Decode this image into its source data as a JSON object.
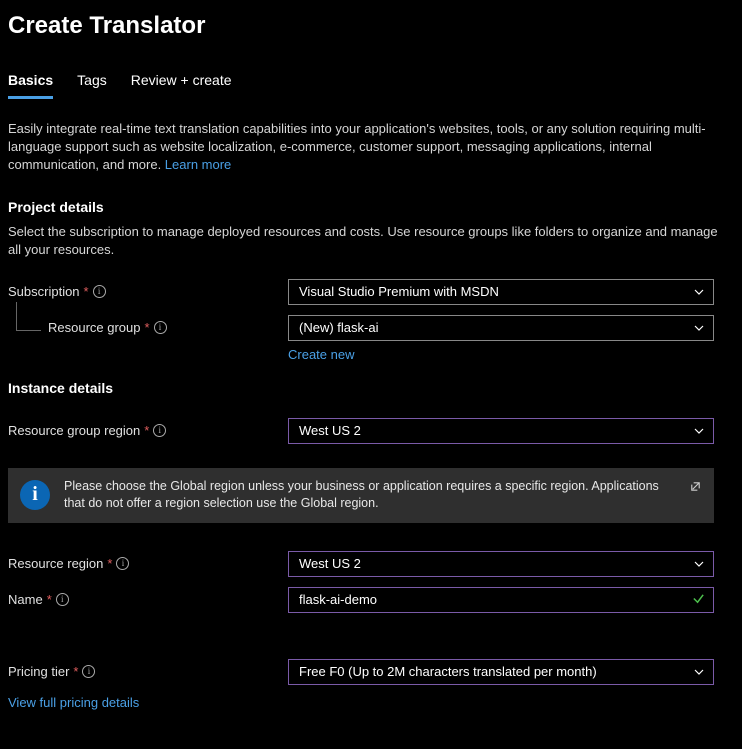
{
  "title": "Create Translator",
  "tabs": [
    {
      "label": "Basics",
      "active": true
    },
    {
      "label": "Tags",
      "active": false
    },
    {
      "label": "Review + create",
      "active": false
    }
  ],
  "intro": "Easily integrate real-time text translation capabilities into your application's websites, tools, or any solution requiring multi-language support such as website localization, e-commerce, customer support, messaging applications, internal communication, and more. ",
  "learn_more": "Learn more",
  "project": {
    "title": "Project details",
    "desc": "Select the subscription to manage deployed resources and costs. Use resource groups like folders to organize and manage all your resources.",
    "subscription_label": "Subscription",
    "subscription_value": "Visual Studio Premium with MSDN",
    "resource_group_label": "Resource group",
    "resource_group_value": "(New) flask-ai",
    "create_new": "Create new"
  },
  "instance": {
    "title": "Instance details",
    "rg_region_label": "Resource group region",
    "rg_region_value": "West US 2",
    "info": "Please choose the Global region unless your business or application requires a specific region. Applications that do not offer a region selection use the Global region.",
    "resource_region_label": "Resource region",
    "resource_region_value": "West US 2",
    "name_label": "Name",
    "name_value": "flask-ai-demo",
    "pricing_label": "Pricing tier",
    "pricing_value": "Free F0 (Up to 2M characters translated per month)",
    "pricing_link": "View full pricing details"
  }
}
